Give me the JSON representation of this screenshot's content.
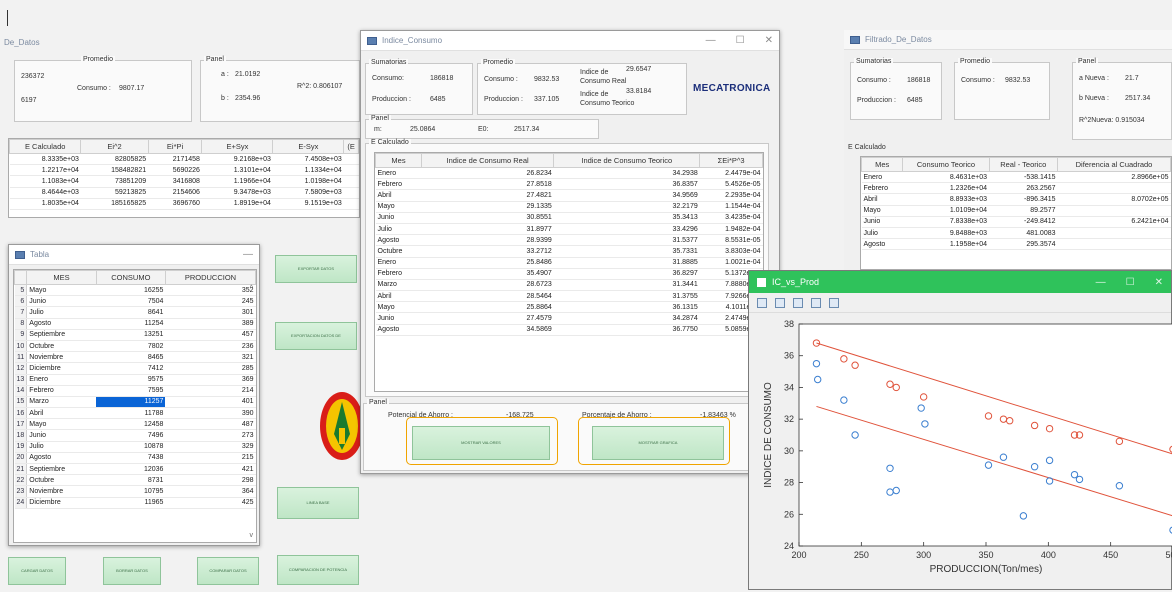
{
  "bg_window": {
    "title": "De_Datos",
    "promedio": {
      "label": "Promedio",
      "consumo_label": "Consumo :",
      "consumo_value": "9807.17",
      "v1": "236372",
      "v2": "6197"
    },
    "panel": {
      "label": "Panel",
      "a_label": "a :",
      "a_value": "21.0192",
      "b_label": "b :",
      "b_value": "2354.96",
      "r2_label": "R^2: 0.806107"
    },
    "table": {
      "headers": [
        "E Calculado",
        "Ei^2",
        "Ei*Pi",
        "E+Syx",
        "E-Syx",
        "(E"
      ],
      "rows": [
        [
          "8.3335e+03",
          "82805825",
          "2171458",
          "9.2168e+03",
          "7.4508e+03"
        ],
        [
          "1.2217e+04",
          "158482821",
          "5690226",
          "1.3101e+04",
          "1.1334e+04"
        ],
        [
          "1.1083e+04",
          "73851209",
          "3416808",
          "1.1966e+04",
          "1.0198e+04"
        ],
        [
          "8.4644e+03",
          "59213825",
          "2154606",
          "9.3478e+03",
          "7.5809e+03"
        ],
        [
          "1.8035e+04",
          "185165825",
          "3696760",
          "1.8919e+04",
          "9.1519e+03"
        ]
      ]
    }
  },
  "tabla": {
    "title": "Tabla",
    "headers": [
      "MES",
      "CONSUMO",
      "PRODUCCION"
    ],
    "rows": [
      [
        "5",
        "Mayo",
        "16255",
        "352"
      ],
      [
        "6",
        "Junio",
        "7504",
        "245"
      ],
      [
        "7",
        "Julio",
        "8641",
        "301"
      ],
      [
        "8",
        "Agosto",
        "11254",
        "389"
      ],
      [
        "9",
        "Septiembre",
        "13251",
        "457"
      ],
      [
        "10",
        "Octubre",
        "7802",
        "236"
      ],
      [
        "11",
        "Noviembre",
        "8465",
        "321"
      ],
      [
        "12",
        "Diciembre",
        "7412",
        "285"
      ],
      [
        "13",
        "Enero",
        "9575",
        "369"
      ],
      [
        "14",
        "Febrero",
        "7595",
        "214"
      ],
      [
        "15",
        "Marzo",
        "11257",
        "401"
      ],
      [
        "16",
        "Abril",
        "11788",
        "390"
      ],
      [
        "17",
        "Mayo",
        "12458",
        "487"
      ],
      [
        "18",
        "Junio",
        "7496",
        "273"
      ],
      [
        "19",
        "Julio",
        "10878",
        "329"
      ],
      [
        "20",
        "Agosto",
        "7438",
        "215"
      ],
      [
        "21",
        "Septiembre",
        "12036",
        "421"
      ],
      [
        "22",
        "Octubre",
        "8731",
        "298"
      ],
      [
        "23",
        "Noviembre",
        "10795",
        "364"
      ],
      [
        "24",
        "Diciembre",
        "11965",
        "425"
      ]
    ],
    "selected_row": 10
  },
  "bg_buttons": {
    "b1": "EXPORTAR DATOS",
    "b2": "EXPORTACION DATOS DE",
    "b3": "LINEA BASE",
    "b4": "CARGAR DATOS",
    "b5": "BORRAR DATOS",
    "b6": "COMPARAR DATOS",
    "b7": "COMPARACION DE POTENCIA"
  },
  "indice": {
    "title": "Indice_Consumo",
    "sumatorias": {
      "label": "Sumatorias",
      "consumo_label": "Consumo:",
      "consumo_value": "186818",
      "produccion_label": "Produccion :",
      "produccion_value": "6485"
    },
    "promedio": {
      "label": "Promedio",
      "consumo_label": "Consumo :",
      "consumo_value": "9832.53",
      "produccion_label": "Produccion :",
      "produccion_value": "337.105"
    },
    "ic_real": {
      "label1": "Indice de",
      "label2": "Consumo Real",
      "value": "29.6547"
    },
    "ic_teorico": {
      "label1": "Indice de",
      "label2": "Consumo Teorico",
      "value": "33.8184"
    },
    "logo": "MECATRONICA",
    "panel": {
      "label": "Panel",
      "m_label": "m:",
      "m_value": "25.0864",
      "e0_label": "E0:",
      "e0_value": "2517.34"
    },
    "calc_label": "E Calculado",
    "table": {
      "headers": [
        "Mes",
        "Indice de Consumo Real",
        "Indice de Consumo Teorico",
        "ΣEi*P^3"
      ],
      "rows": [
        [
          "Enero",
          "26.8234",
          "34.2938",
          "2.4479e-04"
        ],
        [
          "Febrero",
          "27.8518",
          "36.8357",
          "5.4526e-05"
        ],
        [
          "Abril",
          "27.4821",
          "34.9569",
          "2.2935e-04"
        ],
        [
          "Mayo",
          "29.1335",
          "32.2179",
          "1.1544e-04"
        ],
        [
          "Junio",
          "30.8551",
          "35.3413",
          "3.4235e-04"
        ],
        [
          "Julio",
          "31.8977",
          "33.4296",
          "1.9482e-04"
        ],
        [
          "Agosto",
          "28.9399",
          "31.5377",
          "8.5531e-05"
        ],
        [
          "Octubre",
          "33.2712",
          "35.7331",
          "3.8303e-04"
        ],
        [
          "Enero",
          "25.8486",
          "31.8885",
          "1.0021e-04"
        ],
        [
          "Febrero",
          "35.4907",
          "36.8297",
          "5.1372e-04"
        ],
        [
          "Marzo",
          "28.6723",
          "31.3441",
          "7.8880e-05"
        ],
        [
          "Abril",
          "28.5464",
          "31.3755",
          "7.9266e-05"
        ],
        [
          "Mayo",
          "25.8864",
          "36.1315",
          "4.1011e-05"
        ],
        [
          "Junio",
          "27.4579",
          "34.2874",
          "2.4749e-04"
        ],
        [
          "Agosto",
          "34.5869",
          "36.7750",
          "5.0859e-04"
        ]
      ]
    },
    "ahorro": {
      "panel": "Panel",
      "pot_label": "Potencial de Ahorro :",
      "pot_value": "-168.725",
      "pct_label": "Porcentaje de Ahorro :",
      "pct_value": "-1.83463 %"
    },
    "btn_valores": "MOSTRAR VALORES",
    "btn_grafica": "MOSTRAR GRAFICA"
  },
  "filtrado": {
    "title": "Filtrado_De_Datos",
    "sumatorias": {
      "label": "Sumatorias",
      "consumo_label": "Consumo :",
      "consumo_value": "186818",
      "produccion_label": "Produccion :",
      "produccion_value": "6485"
    },
    "promedio": {
      "label": "Promedio",
      "consumo_label": "Consumo :",
      "consumo_value": "9832.53"
    },
    "panel": {
      "label": "Panel",
      "a_label": "a Nueva :",
      "a_value": "21.7",
      "b_label": "b Nueva :",
      "b_value": "2517.34",
      "r2_label": "R^2Nueva: 0.915034"
    },
    "calc_label": "E Calculado",
    "table": {
      "headers": [
        "Mes",
        "Consumo Teorico",
        "Real - Teorico",
        "Diferencia al Cuadrado"
      ],
      "rows": [
        [
          "Enero",
          "8.4631e+03",
          "-538.1415",
          "2.8966e+05"
        ],
        [
          "Febrero",
          "1.2326e+04",
          "263.2567",
          ""
        ],
        [
          "Abril",
          "8.8933e+03",
          "-896.3415",
          "8.0702e+05"
        ],
        [
          "Mayo",
          "1.0109e+04",
          "89.2577",
          ""
        ],
        [
          "Junio",
          "7.8338e+03",
          "-249.8412",
          "6.2421e+04"
        ],
        [
          "Julio",
          "9.8488e+03",
          "481.0083",
          ""
        ],
        [
          "Agosto",
          "1.1958e+04",
          "295.3574",
          ""
        ]
      ]
    }
  },
  "figure": {
    "title": "IC_vs_Prod",
    "tools": [
      "zoom-in-icon",
      "zoom-out-icon",
      "rotate-icon",
      "pan-icon",
      "datacursor-icon"
    ]
  },
  "chart_data": {
    "type": "scatter",
    "title": "",
    "xlabel": "PRODUCCION(Ton/mes)",
    "ylabel": "INDICE DE CONSUMO",
    "xlim": [
      200,
      500
    ],
    "ylim": [
      24,
      38
    ],
    "xticks": [
      200,
      250,
      300,
      350,
      400,
      450,
      500
    ],
    "yticks": [
      24,
      26,
      28,
      30,
      32,
      34,
      36,
      38
    ],
    "series": [
      {
        "color": "#e0533b",
        "marker": "circle",
        "x": [
          214,
          236,
          245,
          273,
          278,
          300,
          352,
          364,
          369,
          389,
          401,
          421,
          425,
          457,
          500
        ],
        "y": [
          36.8,
          35.8,
          35.4,
          34.2,
          34.0,
          33.4,
          32.2,
          32.0,
          31.9,
          31.6,
          31.4,
          31.0,
          31.0,
          30.6,
          30.1
        ]
      },
      {
        "color": "#3b7fd0",
        "marker": "circle",
        "x": [
          214,
          215,
          236,
          245,
          273,
          273,
          278,
          298,
          301,
          352,
          364,
          380,
          389,
          401,
          401,
          421,
          425,
          457,
          500
        ],
        "y": [
          35.5,
          34.5,
          33.2,
          31.0,
          28.9,
          27.4,
          27.5,
          32.7,
          31.7,
          29.1,
          29.6,
          25.9,
          29.0,
          29.4,
          28.1,
          28.5,
          28.2,
          27.8,
          25.0
        ]
      }
    ],
    "lines": [
      {
        "color": "#e0533b",
        "x": [
          214,
          500
        ],
        "y": [
          36.8,
          29.8
        ]
      },
      {
        "color": "#e0533b",
        "x": [
          214,
          500
        ],
        "y": [
          32.8,
          25.9
        ]
      }
    ]
  }
}
